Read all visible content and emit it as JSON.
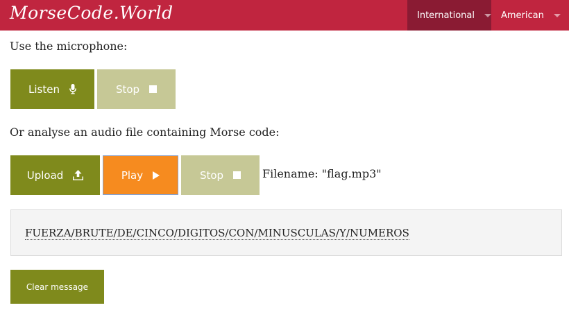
{
  "header": {
    "logo": "MorseCode.World",
    "menu": [
      {
        "label": "International",
        "active": true
      },
      {
        "label": "American",
        "active": false
      }
    ],
    "color": "#c0253f"
  },
  "microphone": {
    "prompt": "Use the microphone:",
    "listen_label": "Listen",
    "stop_label": "Stop"
  },
  "audio_file": {
    "prompt": "Or analyse an audio file containing Morse code:",
    "upload_label": "Upload",
    "play_label": "Play",
    "stop_label": "Stop",
    "filename": "Filename: \"flag.mp3\""
  },
  "message": {
    "decoded_text": "FUERZA/BRUTE/DE/CINCO/DIGITOS/CON/MINUSCULAS/Y/NUMEROS"
  },
  "clear_label": "Clear message",
  "colors": {
    "olive": "#7f8a1c",
    "disabled": "#c6c896",
    "orange": "#f68b1f"
  }
}
